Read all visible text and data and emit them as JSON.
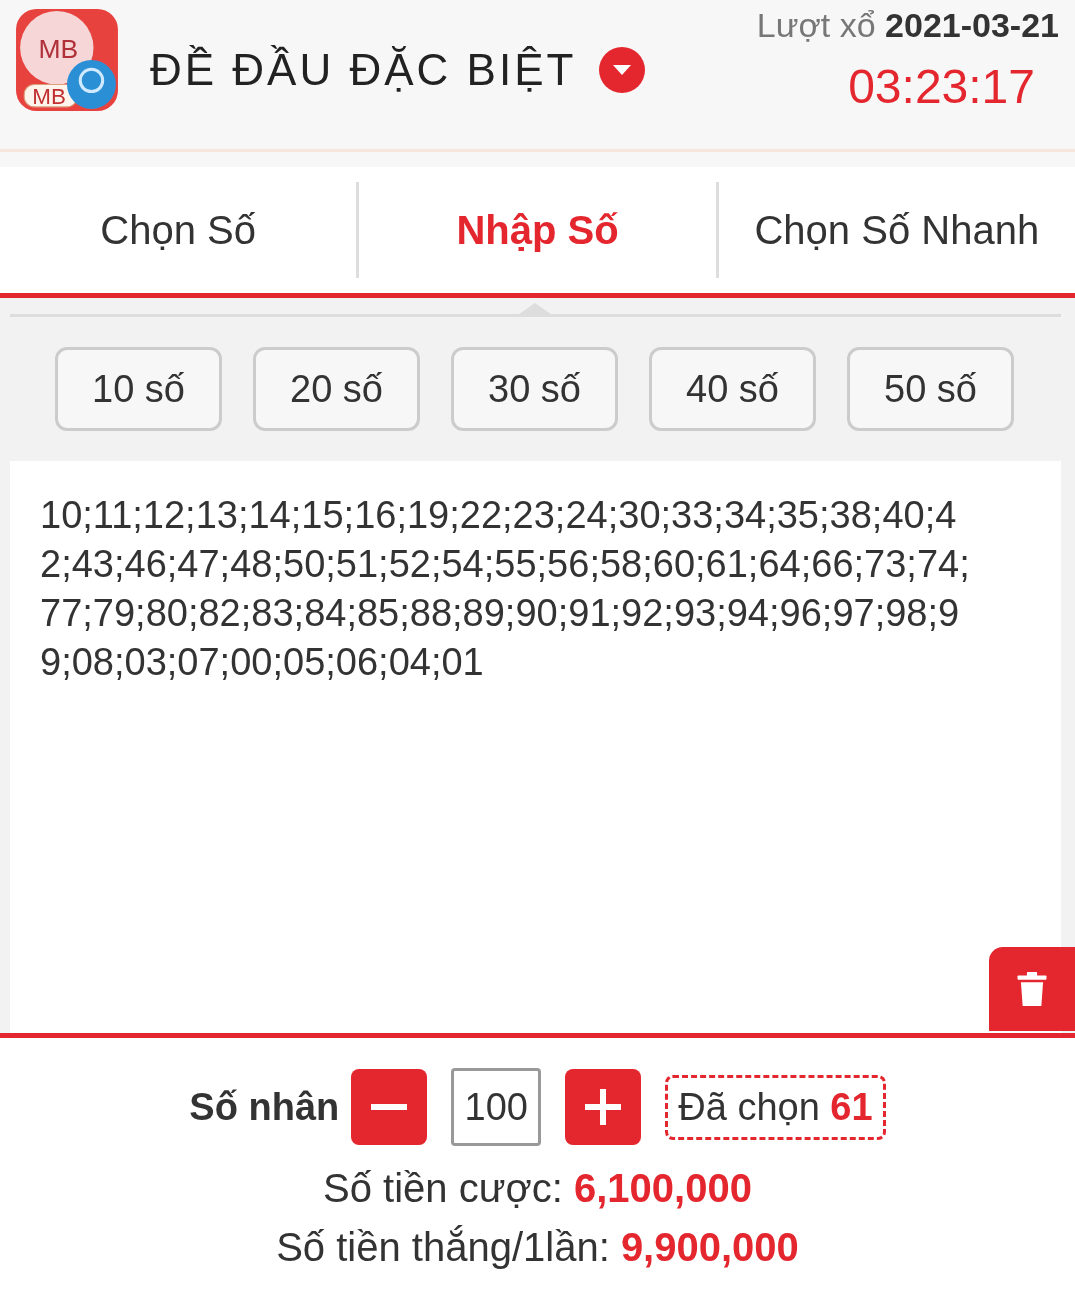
{
  "header": {
    "logo_texts": [
      "MB",
      "MB"
    ],
    "title": "ĐỀ ĐẦU ĐẶC BIỆT",
    "draw_label": "Lượt xổ",
    "draw_date": "2021-03-21",
    "countdown": "03:23:17"
  },
  "tabs": [
    {
      "label": "Chọn Số",
      "selected": false
    },
    {
      "label": "Nhập Số",
      "selected": true
    },
    {
      "label": "Chọn Số Nhanh",
      "selected": false
    }
  ],
  "quick_picks": [
    "10 số",
    "20 số",
    "30 số",
    "40 số",
    "50 số"
  ],
  "numbers_input": {
    "value": "10;11;12;13;14;15;16;19;22;23;24;30;33;34;35;38;40;42;43;46;47;48;50;51;52;54;55;56;58;60;61;64;66;73;74;77;79;80;82;83;84;85;88;89;90;91;92;93;94;96;97;98;99;08;03;07;00;05;06;04;01"
  },
  "multiplier": {
    "label": "Số nhân",
    "value": "100",
    "chosen_label": "Đã chọn",
    "chosen_count": "61"
  },
  "totals": [
    {
      "label": "Số tiền cược:",
      "value": "6,100,000"
    },
    {
      "label": "Số tiền thắng/1lần:",
      "value": "9,900,000"
    }
  ]
}
